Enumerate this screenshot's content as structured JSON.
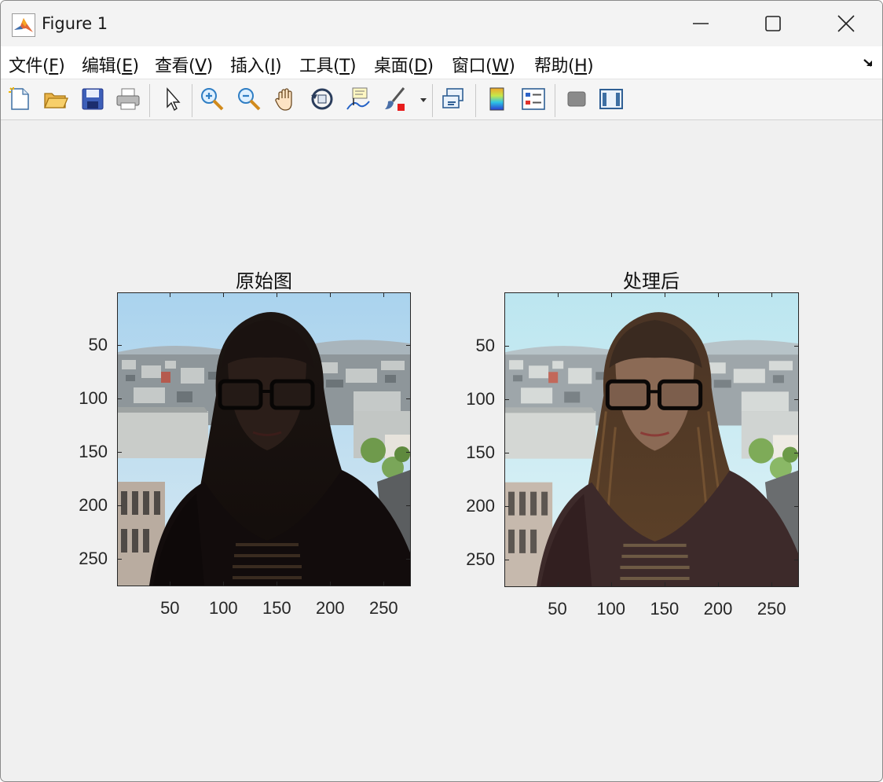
{
  "window": {
    "title": "Figure 1"
  },
  "menu": [
    {
      "text": "文件(",
      "key": "F",
      "end": ")"
    },
    {
      "text": "编辑(",
      "key": "E",
      "end": ")"
    },
    {
      "text": "查看(",
      "key": "V",
      "end": ")"
    },
    {
      "text": "插入(",
      "key": "I",
      "end": ")"
    },
    {
      "text": "工具(",
      "key": "T",
      "end": ")"
    },
    {
      "text": "桌面(",
      "key": "D",
      "end": ")"
    },
    {
      "text": "窗口(",
      "key": "W",
      "end": ")"
    },
    {
      "text": "帮助(",
      "key": "H",
      "end": ")"
    }
  ],
  "toolbar_icons": [
    "new-figure-icon",
    "open-file-icon",
    "save-icon",
    "print-icon",
    "pointer-icon",
    "zoom-in-icon",
    "zoom-out-icon",
    "pan-hand-icon",
    "rotate-3d-icon",
    "data-cursor-icon",
    "brush-icon",
    "link-plot-icon",
    "colorbar-icon",
    "legend-icon",
    "hide-plot-tools-icon",
    "show-plot-tools-icon"
  ],
  "axes": [
    {
      "title": "原始图",
      "xticks": [
        "50",
        "100",
        "150",
        "200",
        "250"
      ],
      "yticks": [
        "50",
        "100",
        "150",
        "200",
        "250"
      ],
      "image": "original"
    },
    {
      "title": "处理后",
      "xticks": [
        "50",
        "100",
        "150",
        "200",
        "250"
      ],
      "yticks": [
        "50",
        "100",
        "150",
        "200",
        "250"
      ],
      "image": "processed"
    }
  ]
}
